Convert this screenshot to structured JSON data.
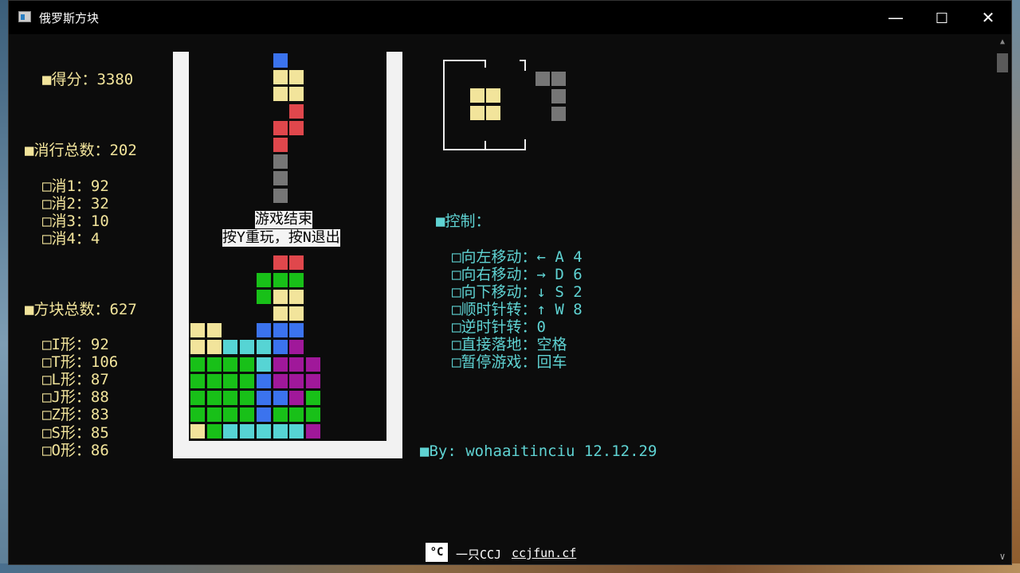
{
  "window": {
    "title": "俄罗斯方块",
    "minimize_icon": "minimize-icon",
    "maximize_icon": "maximize-icon",
    "close_icon": "close-icon"
  },
  "colors": {
    "yellow": "#f2e49b",
    "cyan": "#5fd3d3",
    "red": "#e0474c",
    "green": "#18c018",
    "blue": "#3b73ee",
    "purple": "#a0189a",
    "gray": "#767676",
    "aqua": "#56d4d4"
  },
  "stats": {
    "score": "■得分：3380",
    "lines_total": "■消行总数：202",
    "lines": [
      "□消1：92",
      "□消2：32",
      "□消3：10",
      "□消4：4"
    ],
    "blocks_total": "■方块总数：627",
    "blocks": [
      "□I形：92",
      "□T形：106",
      "□L形：87",
      "□J形：88",
      "□Z形：83",
      "□S形：85",
      "□O形：86"
    ]
  },
  "controls": {
    "heading": "■控制：",
    "items": [
      "□向左移动：← A 4",
      "□向右移动：→ D 6",
      "□向下移动：↓ S 2",
      "□顺时针转：↑ W 8",
      "□逆时针转：0",
      "□直接落地：空格",
      "□暂停游戏：回车"
    ]
  },
  "credit": "■By: wohaaitinciu 12.12.29",
  "game_over": {
    "line1": "游戏结束",
    "line2": "按Y重玩，按N退出"
  },
  "board": {
    "cols": 12,
    "cells": [
      [
        0,
        5,
        "blue"
      ],
      [
        1,
        5,
        "yellow"
      ],
      [
        1,
        6,
        "yellow"
      ],
      [
        2,
        5,
        "yellow"
      ],
      [
        2,
        6,
        "yellow"
      ],
      [
        3,
        6,
        "red"
      ],
      [
        4,
        5,
        "red"
      ],
      [
        4,
        6,
        "red"
      ],
      [
        5,
        5,
        "red"
      ],
      [
        6,
        5,
        "gray"
      ],
      [
        7,
        5,
        "gray"
      ],
      [
        8,
        5,
        "gray"
      ],
      [
        12,
        5,
        "red"
      ],
      [
        12,
        6,
        "red"
      ],
      [
        13,
        4,
        "green"
      ],
      [
        13,
        5,
        "green"
      ],
      [
        13,
        6,
        "green"
      ],
      [
        14,
        4,
        "green"
      ],
      [
        14,
        5,
        "yellow"
      ],
      [
        14,
        6,
        "yellow"
      ],
      [
        15,
        5,
        "yellow"
      ],
      [
        15,
        6,
        "yellow"
      ],
      [
        16,
        0,
        "yellow"
      ],
      [
        16,
        1,
        "yellow"
      ],
      [
        16,
        4,
        "blue"
      ],
      [
        16,
        5,
        "blue"
      ],
      [
        16,
        6,
        "blue"
      ],
      [
        17,
        0,
        "yellow"
      ],
      [
        17,
        1,
        "yellow"
      ],
      [
        17,
        2,
        "aqua"
      ],
      [
        17,
        3,
        "aqua"
      ],
      [
        17,
        4,
        "aqua"
      ],
      [
        17,
        5,
        "blue"
      ],
      [
        17,
        6,
        "purple"
      ],
      [
        18,
        0,
        "green"
      ],
      [
        18,
        1,
        "green"
      ],
      [
        18,
        2,
        "green"
      ],
      [
        18,
        3,
        "green"
      ],
      [
        18,
        4,
        "aqua"
      ],
      [
        18,
        5,
        "purple"
      ],
      [
        18,
        6,
        "purple"
      ],
      [
        18,
        7,
        "purple"
      ],
      [
        19,
        0,
        "green"
      ],
      [
        19,
        1,
        "green"
      ],
      [
        19,
        2,
        "green"
      ],
      [
        19,
        3,
        "green"
      ],
      [
        19,
        4,
        "blue"
      ],
      [
        19,
        5,
        "purple"
      ],
      [
        19,
        6,
        "purple"
      ],
      [
        19,
        7,
        "purple"
      ],
      [
        20,
        0,
        "green"
      ],
      [
        20,
        1,
        "green"
      ],
      [
        20,
        2,
        "green"
      ],
      [
        20,
        3,
        "green"
      ],
      [
        20,
        4,
        "blue"
      ],
      [
        20,
        5,
        "blue"
      ],
      [
        20,
        6,
        "purple"
      ],
      [
        20,
        7,
        "green"
      ],
      [
        21,
        0,
        "green"
      ],
      [
        21,
        1,
        "green"
      ],
      [
        21,
        2,
        "green"
      ],
      [
        21,
        3,
        "green"
      ],
      [
        21,
        4,
        "blue"
      ],
      [
        21,
        5,
        "green"
      ],
      [
        21,
        6,
        "green"
      ],
      [
        21,
        7,
        "green"
      ],
      [
        22,
        0,
        "yellow"
      ],
      [
        22,
        1,
        "green"
      ],
      [
        22,
        2,
        "aqua"
      ],
      [
        22,
        3,
        "aqua"
      ],
      [
        22,
        4,
        "aqua"
      ],
      [
        22,
        5,
        "aqua"
      ],
      [
        22,
        6,
        "aqua"
      ],
      [
        22,
        7,
        "purple"
      ]
    ]
  },
  "next_piece": {
    "shape": "O",
    "color": "yellow"
  },
  "held_piece": {
    "shape": "J",
    "color": "gray"
  },
  "watermark": {
    "logo": "°C",
    "text": "一只CCJ",
    "link": "ccjfun.cf"
  }
}
